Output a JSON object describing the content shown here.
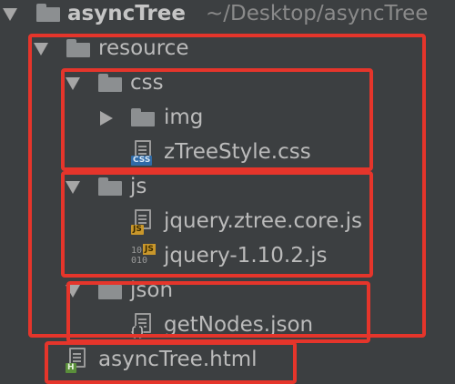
{
  "project": {
    "name": "asyncTree",
    "path": "~/Desktop/asyncTree"
  },
  "tree": {
    "resource": "resource",
    "css": "css",
    "img": "img",
    "ztree_css": "zTreeStyle.css",
    "js": "js",
    "ztree_js": "jquery.ztree.core.js",
    "jquery_js": "jquery-1.10.2.js",
    "json": "json",
    "nodes_json": "getNodes.json",
    "html_file": "asyncTree.html"
  },
  "badges": {
    "css": "CSS",
    "js": "JS",
    "html": "H",
    "binary": "10\n010"
  },
  "colors": {
    "highlight": "#e5352b",
    "background": "#3c3f41",
    "css_badge": "#2f6aa6",
    "js_badge": "#c9972b",
    "html_badge": "#5a8f3a"
  }
}
